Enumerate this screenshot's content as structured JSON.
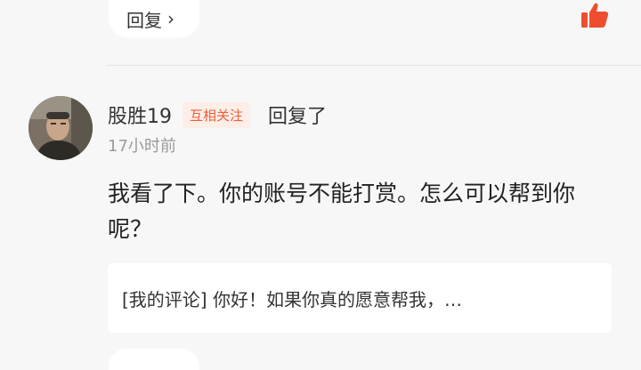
{
  "prev_reply": {
    "label": "回复",
    "chevron": "›"
  },
  "like": {
    "icon": "thumbs-up-icon",
    "color": "#ee4e30"
  },
  "comment": {
    "username": "股胜19",
    "badge": "互相关注",
    "action": "回复了",
    "time": "17小时前",
    "body": "我看了下。你的账号不能打赏。怎么可以帮到你呢？",
    "quote": "[我的评论] 你好！如果你真的愿意帮我，…"
  },
  "colors": {
    "accent": "#ef5d3a",
    "badge_bg": "#fdeee8",
    "page_bg": "#f7f7f7"
  }
}
